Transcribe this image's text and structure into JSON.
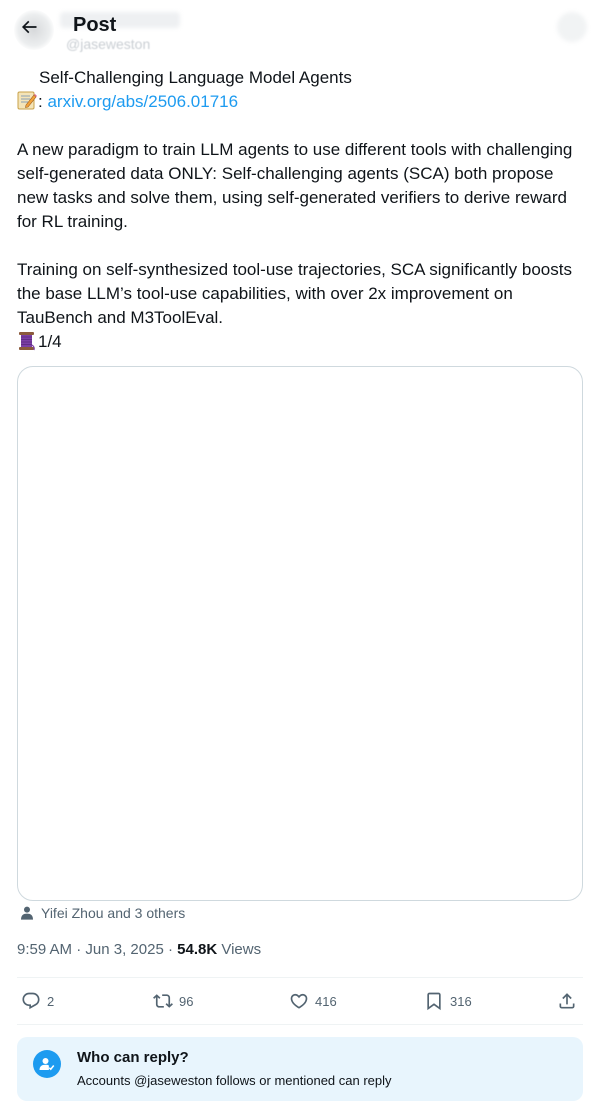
{
  "header": {
    "title": "Post",
    "ghost_handle": "@jaseweston"
  },
  "tweet": {
    "title_line": "Self-Challenging Language Model Agents",
    "link_prefix": ":",
    "link_text": "arxiv.org/abs/2506.01716",
    "paragraph1": "A new paradigm to train LLM agents to use different tools with challenging self-generated data ONLY: Self-challenging agents (SCA) both propose new tasks and solve them, using self-generated verifiers to derive reward for RL training.",
    "paragraph2": "Training on self-synthesized tool-use trajectories, SCA significantly boosts the base LLM’s tool-use capabilities, with over 2x improvement on TauBench and M3ToolEval.",
    "thread_counter": "1/4"
  },
  "tagged": {
    "text": "Yifei Zhou and 3 others",
    "icon": "person-icon"
  },
  "meta": {
    "time": "9:59 AM",
    "separator": " · ",
    "date": "Jun 3, 2025",
    "views_count": "54.8K",
    "views_label": " Views"
  },
  "actions": {
    "replies": "2",
    "reposts": "96",
    "likes": "416",
    "bookmarks": "316"
  },
  "reply_settings": {
    "title": "Who can reply?",
    "description": "Accounts @jaseweston follows or mentioned can reply"
  },
  "colors": {
    "accent": "#1d9bf0",
    "text": "#0f1419",
    "secondary": "#536471",
    "border": "#cfd9de",
    "reply_bg": "#e8f5fd"
  }
}
